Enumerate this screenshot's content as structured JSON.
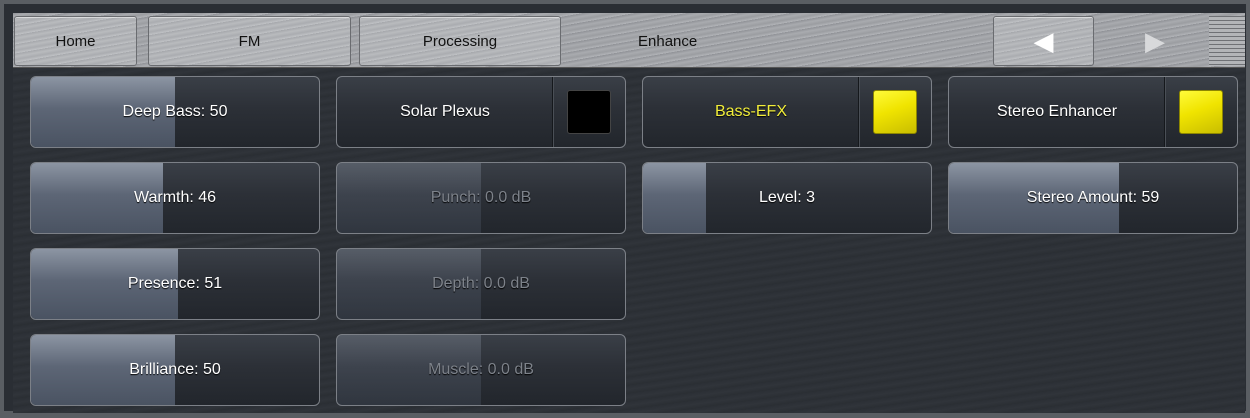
{
  "nav": {
    "home": "Home",
    "fm": "FM",
    "processing": "Processing",
    "current": "Enhance",
    "back_icon": "triangle-left",
    "forward_icon": "triangle-right",
    "menu_icon": "hamburger"
  },
  "controls": {
    "deep_bass": {
      "label": "Deep Bass: 50",
      "level": 0.5
    },
    "warmth": {
      "label": "Warmth: 46",
      "level": 0.46
    },
    "presence": {
      "label": "Presence: 51",
      "level": 0.51
    },
    "brilliance": {
      "label": "Brilliance: 50",
      "level": 0.5
    },
    "punch": {
      "label": "Punch: 0.0 dB",
      "level": 0.5,
      "enabled": false
    },
    "depth": {
      "label": "Depth: 0.0 dB",
      "level": 0.5,
      "enabled": false
    },
    "muscle": {
      "label": "Muscle: 0.0 dB",
      "level": 0.5,
      "enabled": false
    },
    "level": {
      "label": "Level: 3",
      "level": 0.22
    },
    "stereo_amount": {
      "label": "Stereo Amount: 59",
      "level": 0.59
    }
  },
  "toggles": {
    "solar_plexus": {
      "label": "Solar Plexus",
      "on": false
    },
    "bass_efx": {
      "label": "Bass-EFX",
      "on": true,
      "label_color": "#f2ee3a"
    },
    "stereo_enhancer": {
      "label": "Stereo Enhancer",
      "on": true
    }
  },
  "colors": {
    "toggle_on": "#f0e400",
    "toggle_off": "#000000"
  }
}
